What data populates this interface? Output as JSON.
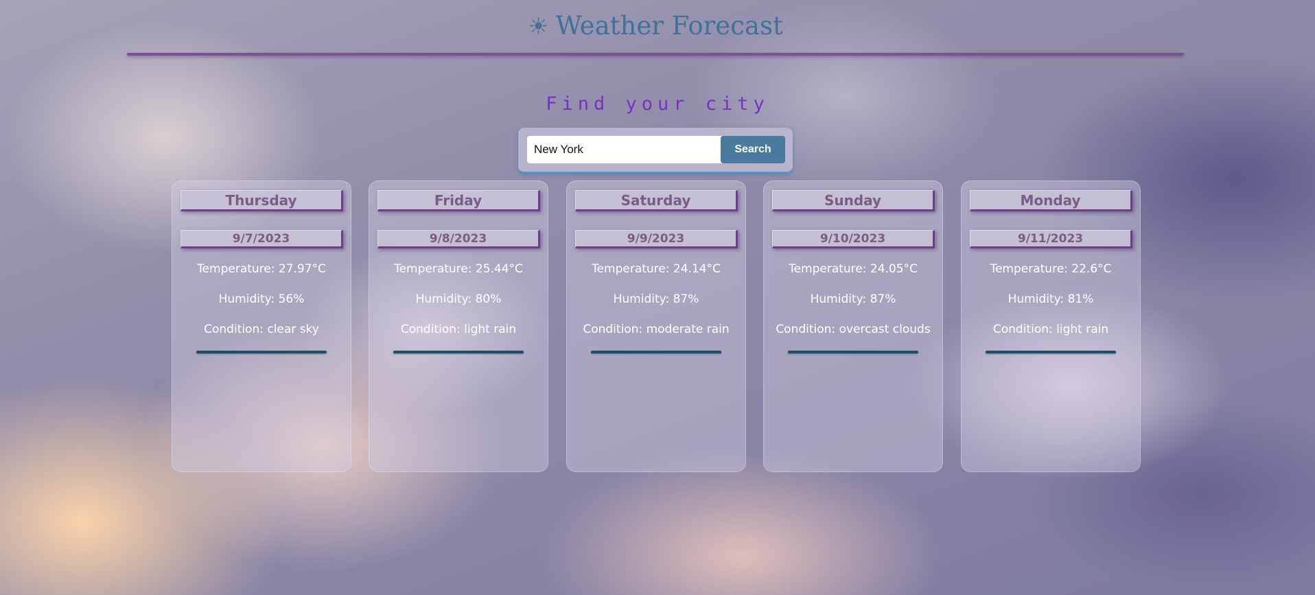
{
  "header": {
    "icon": "sun-icon",
    "icon_glyph": "☀",
    "title": "Weather Forecast"
  },
  "search": {
    "heading": "Find your city",
    "value": "New York",
    "button_label": "Search"
  },
  "forecast": [
    {
      "day": "Thursday",
      "date": "9/7/2023",
      "temperature": "Temperature: 27.97°C",
      "humidity": "Humidity: 56%",
      "condition": "Condition: clear sky"
    },
    {
      "day": "Friday",
      "date": "9/8/2023",
      "temperature": "Temperature: 25.44°C",
      "humidity": "Humidity: 80%",
      "condition": "Condition: light rain"
    },
    {
      "day": "Saturday",
      "date": "9/9/2023",
      "temperature": "Temperature: 24.14°C",
      "humidity": "Humidity: 87%",
      "condition": "Condition: moderate rain"
    },
    {
      "day": "Sunday",
      "date": "9/10/2023",
      "temperature": "Temperature: 24.05°C",
      "humidity": "Humidity: 87%",
      "condition": "Condition: overcast clouds"
    },
    {
      "day": "Monday",
      "date": "9/11/2023",
      "temperature": "Temperature: 22.6°C",
      "humidity": "Humidity: 81%",
      "condition": "Condition: light rain"
    }
  ],
  "colors": {
    "title": "#41719a",
    "find_heading": "#7a2fc6",
    "search_button": "#4b7a9f",
    "header_rule": "#7a5292",
    "card_rule": "#1e4d66"
  }
}
